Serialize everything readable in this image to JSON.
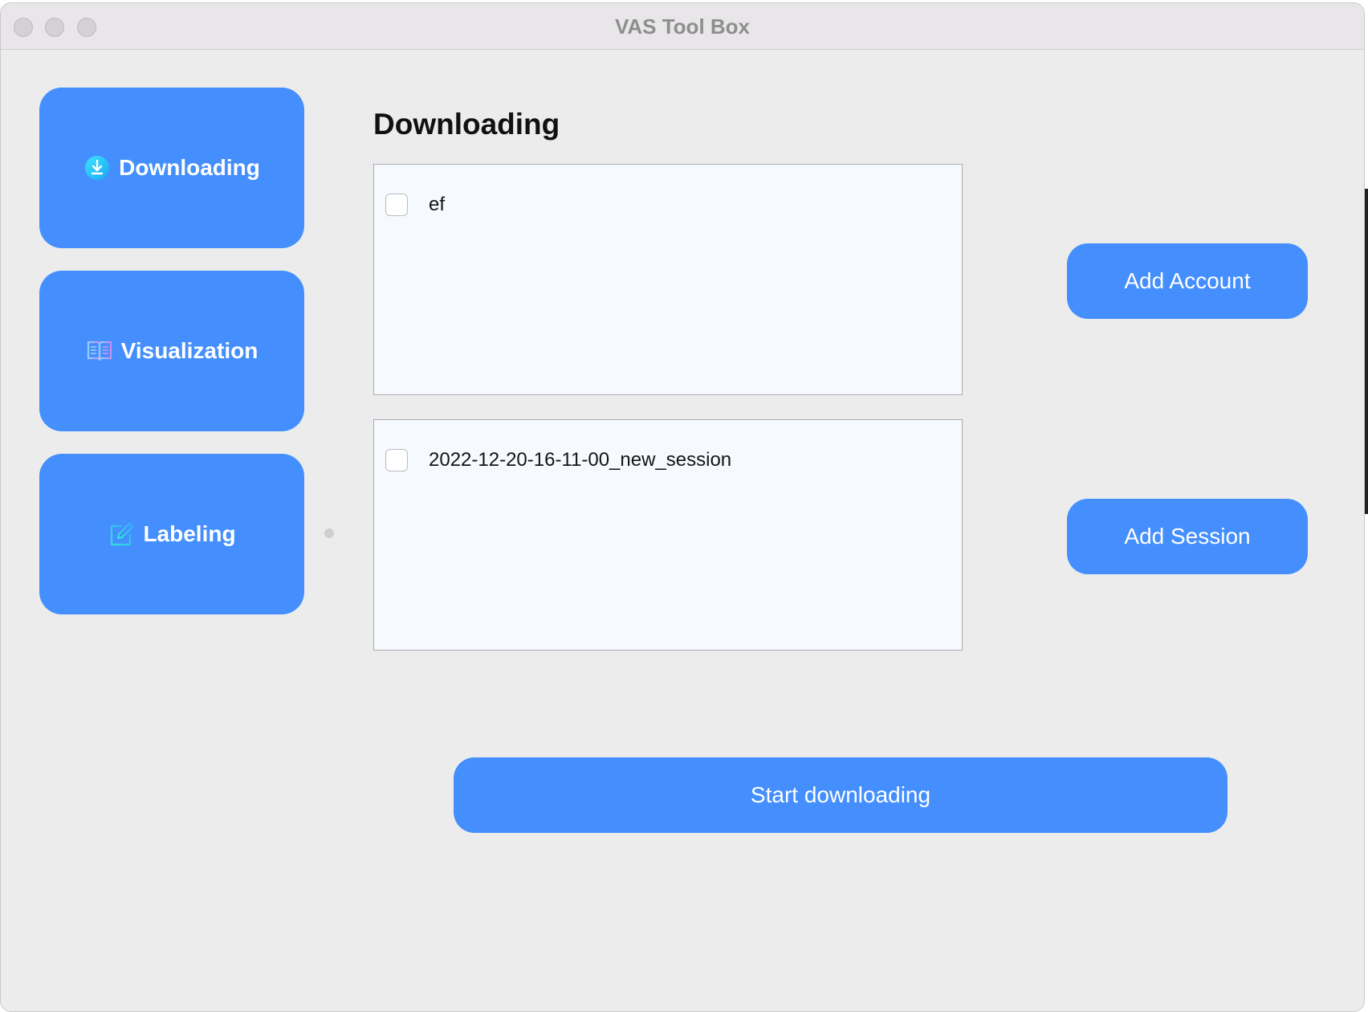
{
  "window": {
    "title": "VAS Tool Box"
  },
  "sidebar": {
    "items": [
      {
        "label": "Downloading",
        "icon": "download-circle-icon"
      },
      {
        "label": "Visualization",
        "icon": "open-book-icon"
      },
      {
        "label": "Labeling",
        "icon": "edit-pencil-icon"
      }
    ]
  },
  "main": {
    "title": "Downloading",
    "accounts": {
      "items": [
        {
          "label": "ef",
          "checked": false
        }
      ]
    },
    "sessions": {
      "items": [
        {
          "label": "2022-12-20-16-11-00_new_session",
          "checked": false
        }
      ]
    },
    "buttons": {
      "add_account": "Add Account",
      "add_session": "Add Session",
      "start": "Start downloading"
    }
  },
  "colors": {
    "accent": "#448ffd",
    "window_bg": "#ececec",
    "list_bg": "#f6fafe"
  }
}
